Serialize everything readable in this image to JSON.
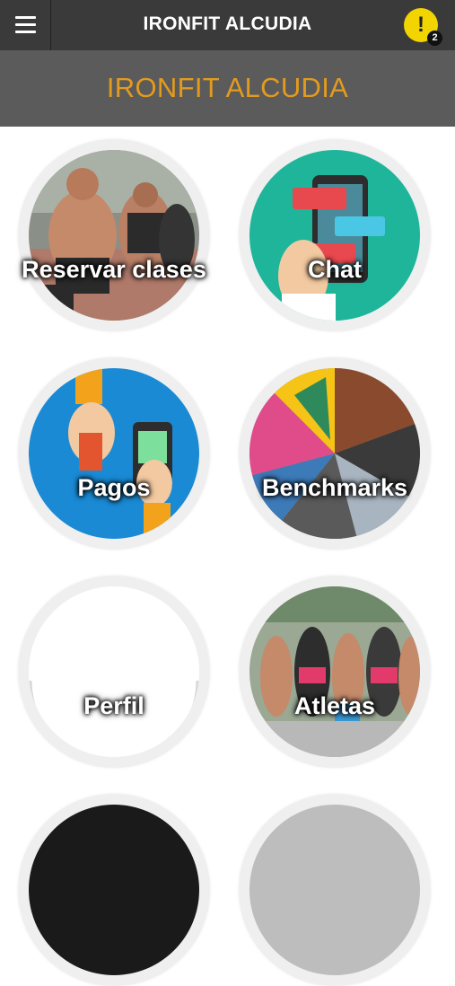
{
  "header": {
    "title": "IRONFIT ALCUDIA",
    "notification_count": "2"
  },
  "banner": {
    "title": "IRONFIT ALCUDIA"
  },
  "tiles": [
    {
      "label": "Reservar clases"
    },
    {
      "label": "Chat"
    },
    {
      "label": "Pagos"
    },
    {
      "label": "Benchmarks"
    },
    {
      "label": "Perfil"
    },
    {
      "label": "Atletas"
    }
  ],
  "colors": {
    "topbar": "#3a3a3a",
    "banner": "#5b5b5b",
    "banner_text": "#e39b1d",
    "alert": "#f2d400"
  }
}
